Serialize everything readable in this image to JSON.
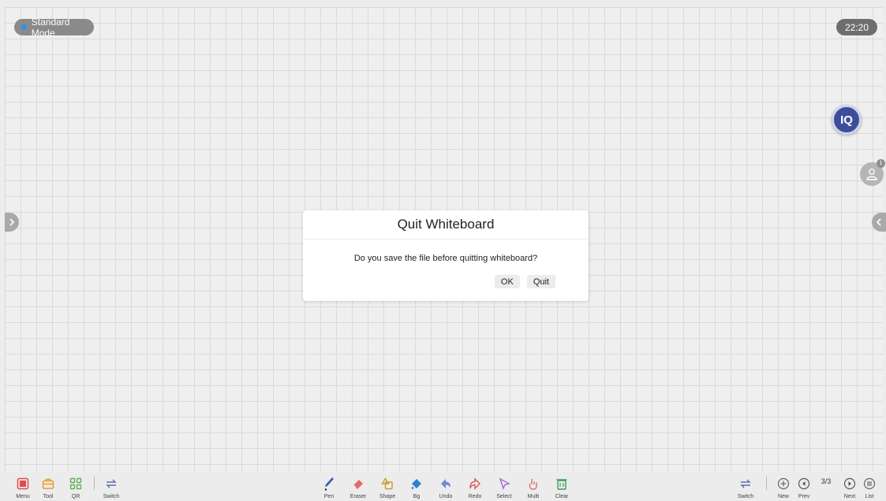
{
  "status_bar": {
    "mode_label": "Standard Mode",
    "time": "22:20"
  },
  "floating": {
    "iq_label": "IQ",
    "user_badge_count": "1"
  },
  "dialog": {
    "title": "Quit Whiteboard",
    "message": "Do you save the file before quitting whiteboard?",
    "ok_label": "OK",
    "quit_label": "Quit"
  },
  "toolbar_left": [
    {
      "label": "Menu",
      "icon": "menu-icon"
    },
    {
      "label": "Tool",
      "icon": "toolbox-icon"
    },
    {
      "label": "QR",
      "icon": "qr-grid-icon"
    },
    {
      "label": "Switch",
      "icon": "switch-icon"
    }
  ],
  "toolbar_center": [
    {
      "label": "Pen",
      "icon": "pen-icon"
    },
    {
      "label": "Eraser",
      "icon": "eraser-icon"
    },
    {
      "label": "Shape",
      "icon": "shape-icon"
    },
    {
      "label": "Bg",
      "icon": "paint-bucket-icon"
    },
    {
      "label": "Undo",
      "icon": "undo-icon"
    },
    {
      "label": "Redo",
      "icon": "redo-icon"
    },
    {
      "label": "Select",
      "icon": "select-arrow-icon"
    },
    {
      "label": "Multi",
      "icon": "multi-touch-icon"
    },
    {
      "label": "Clear",
      "icon": "trash-icon"
    }
  ],
  "toolbar_right": [
    {
      "label": "Switch",
      "icon": "switch-icon"
    },
    {
      "label": "New",
      "icon": "plus-circle-icon"
    },
    {
      "label": "Prev",
      "icon": "prev-page-icon"
    },
    {
      "label": "Next",
      "icon": "next-page-icon"
    },
    {
      "label": "List",
      "icon": "list-icon"
    }
  ],
  "page_counter": "3/3",
  "colors": {
    "accent_blue": "#2f8fe9",
    "menu_red": "#e14b4b",
    "tool_orange": "#e89a2b",
    "qr_green": "#5cae5c",
    "iq_navy": "#3c4e9b",
    "clear_green": "#3a9a5a"
  }
}
